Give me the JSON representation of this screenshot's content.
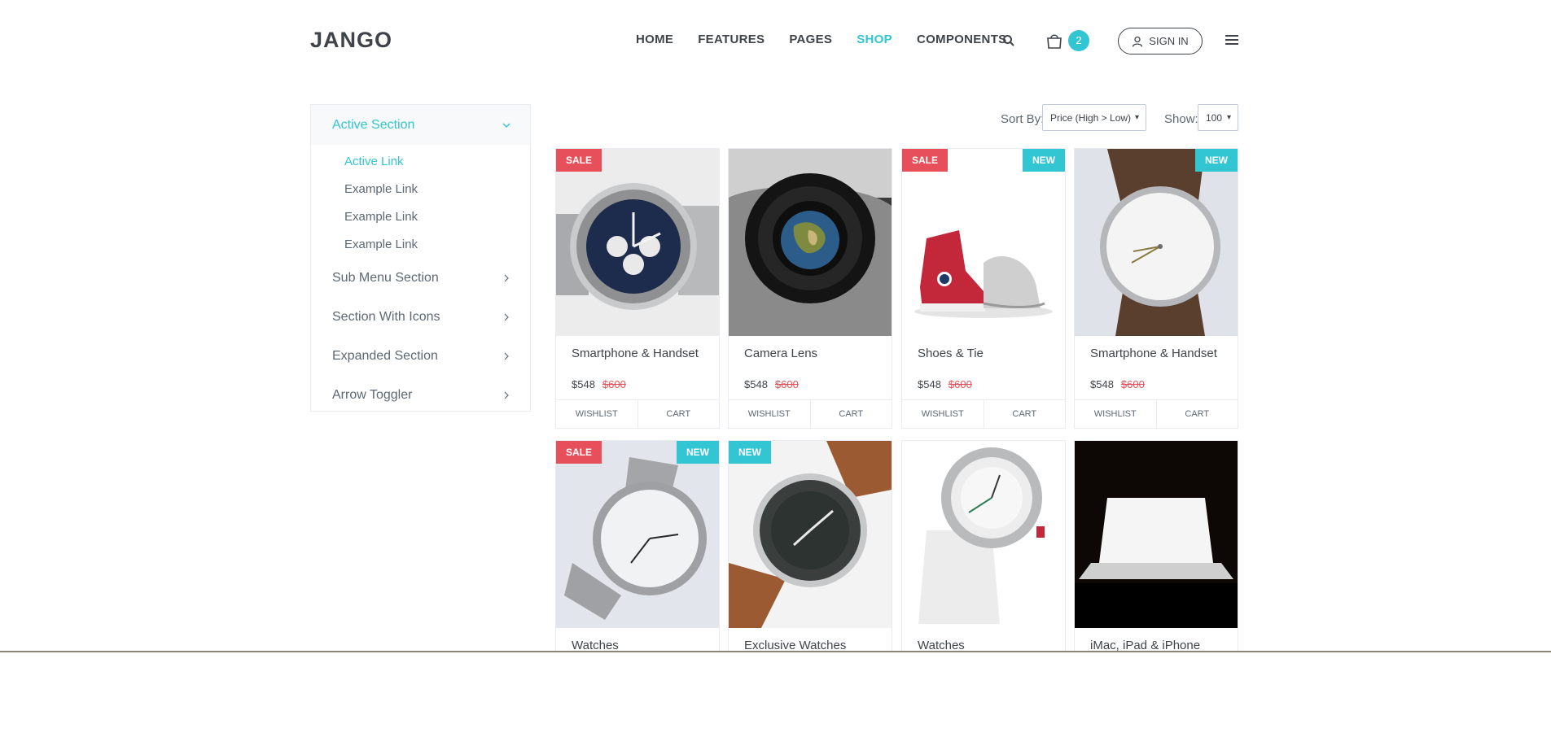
{
  "header": {
    "logo": "JANGO",
    "nav": [
      "HOME",
      "FEATURES",
      "PAGES",
      "SHOP",
      "COMPONENTS"
    ],
    "active_nav": "SHOP",
    "cart_count": "2",
    "signin_label": "SIGN IN",
    "icons": [
      "search-icon",
      "cart-icon",
      "user-icon",
      "menu-icon"
    ]
  },
  "sidebar": {
    "active_section": "Active Section",
    "links": [
      "Active Link",
      "Example Link",
      "Example Link",
      "Example Link"
    ],
    "sections": [
      "Sub Menu Section",
      "Section With Icons",
      "Expanded Section",
      "Arrow Toggler"
    ]
  },
  "toolbar": {
    "sort_label": "Sort By:",
    "sort_value": "Price (High > Low)",
    "show_label": "Show:",
    "show_value": "100"
  },
  "products": [
    {
      "name": "Smartphone & Handset",
      "price": "$548",
      "old_price": "$600",
      "sale": "SALE",
      "new": "",
      "image": "watch-chronograph-blue"
    },
    {
      "name": "Camera Lens",
      "price": "$548",
      "old_price": "$600",
      "sale": "",
      "new": "",
      "image": "camera-lens-earth"
    },
    {
      "name": "Shoes & Tie",
      "price": "$548",
      "old_price": "$600",
      "sale": "SALE",
      "new": "NEW",
      "image": "red-sneakers"
    },
    {
      "name": "Smartphone & Handset",
      "price": "$548",
      "old_price": "$600",
      "sale": "",
      "new": "NEW",
      "image": "watch-leather-brown"
    },
    {
      "name": "Watches",
      "price": "",
      "old_price": "",
      "sale": "SALE",
      "new": "NEW",
      "image": "watch-steel"
    },
    {
      "name": "Exclusive Watches",
      "price": "",
      "old_price": "",
      "sale": "",
      "new": "NEW",
      "image": "watch-leather-tan"
    },
    {
      "name": "Watches",
      "price": "",
      "old_price": "",
      "sale": "",
      "new": "",
      "image": "watch-white"
    },
    {
      "name": "iMac, iPad & iPhone",
      "price": "",
      "old_price": "",
      "sale": "",
      "new": "",
      "image": "laptop-dark"
    }
  ],
  "actions": {
    "wishlist": "WISHLIST",
    "cart": "CART"
  },
  "colors": {
    "accent": "#32c5d2",
    "sale": "#e7505a",
    "text": "#3f444a"
  }
}
